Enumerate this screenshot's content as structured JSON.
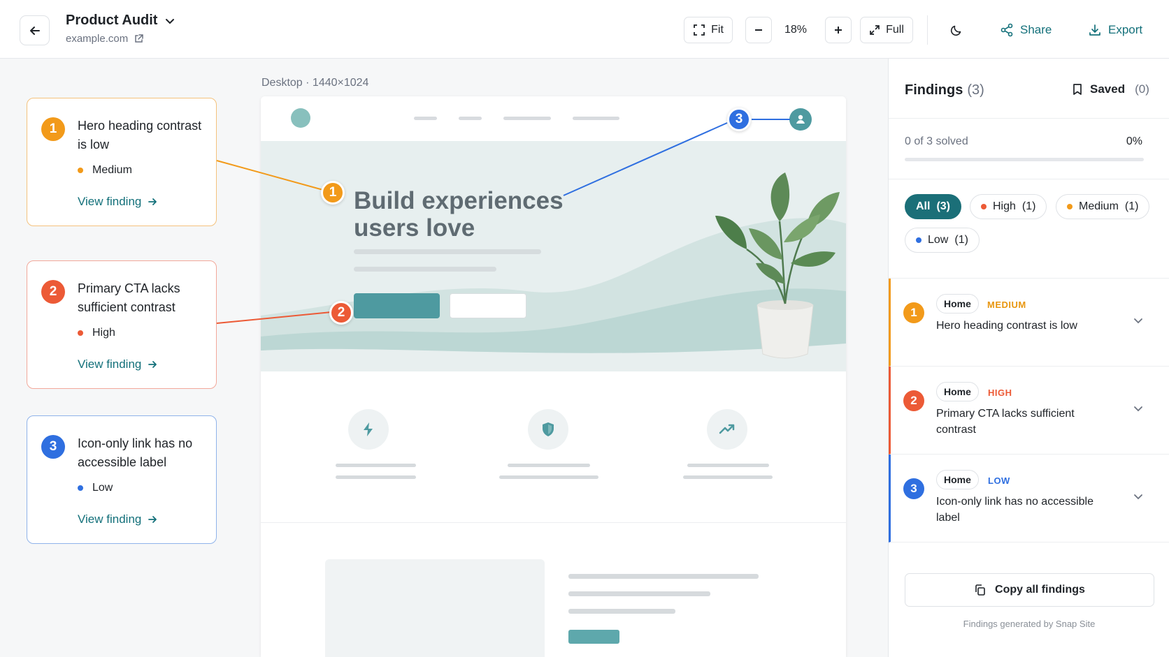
{
  "header": {
    "title": "Product Audit",
    "domain": "example.com",
    "fit_label": "Fit",
    "zoom": "18%",
    "full_label": "Full",
    "share_label": "Share",
    "export_label": "Export"
  },
  "canvas": {
    "frame_label": "Desktop · 1440×1024",
    "headline": "Build experiences users love"
  },
  "callouts": [
    {
      "number": "1",
      "title": "Hero heading contrast is low",
      "severity": "Medium",
      "link": "View finding",
      "color": "#f29a1a"
    },
    {
      "number": "2",
      "title": "Primary CTA lacks sufficient contrast",
      "severity": "High",
      "link": "View finding",
      "color": "#ec5a36"
    },
    {
      "number": "3",
      "title": "Icon-only link has no accessible label",
      "severity": "Low",
      "link": "View finding",
      "color": "#2f6fe0"
    }
  ],
  "panel": {
    "title": "Findings",
    "count": "(3)",
    "saved_label": "Saved",
    "saved_count": "(0)",
    "progress_label": "0 of 3 solved",
    "progress_pct": "0%",
    "progress_value": 0,
    "filters": [
      {
        "label": "All",
        "count": "(3)"
      },
      {
        "label": "High",
        "count": "(1)"
      },
      {
        "label": "Medium",
        "count": "(1)"
      },
      {
        "label": "Low",
        "count": "(1)"
      }
    ],
    "items": [
      {
        "number": "1",
        "page": "Home",
        "severity": "MEDIUM",
        "title": "Hero heading contrast is low"
      },
      {
        "number": "2",
        "page": "Home",
        "severity": "HIGH",
        "title": "Primary CTA lacks sufficient contrast"
      },
      {
        "number": "3",
        "page": "Home",
        "severity": "LOW",
        "title": "Icon-only link has no accessible label"
      }
    ],
    "copy_label": "Copy all findings",
    "footer": "Findings generated by Snap Site"
  },
  "colors": {
    "accent": "#13707a",
    "medium": "#f29a1a",
    "high": "#ec5a36",
    "low": "#2f6fe0"
  },
  "icons": [
    "arrow-left-icon",
    "chevron-down-icon",
    "external-link-icon",
    "fit-icon",
    "minus-icon",
    "plus-icon",
    "expand-icon",
    "moon-icon",
    "share-icon",
    "download-icon",
    "arrow-right-icon",
    "bookmark-icon",
    "user-icon",
    "bolt-icon",
    "shield-icon",
    "trend-up-icon",
    "copy-icon"
  ]
}
